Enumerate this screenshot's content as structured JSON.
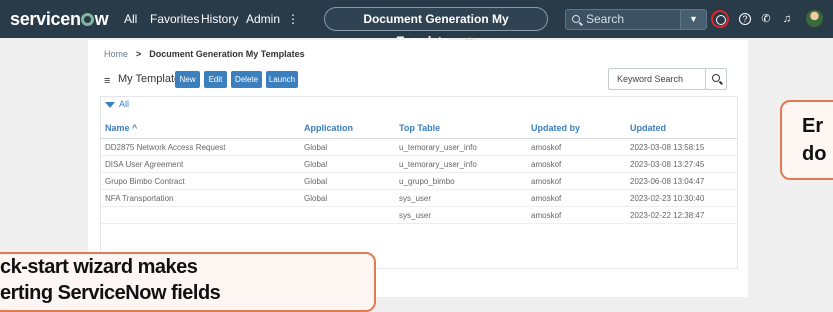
{
  "nav": {
    "logo_before": "servicen",
    "logo_after": "w",
    "items": [
      "All",
      "Favorites",
      "History",
      "Admin",
      "⋮"
    ],
    "document_title": "Document Generation My Template...",
    "star": "☆",
    "search_placeholder": "Search",
    "icons": [
      "globe-icon",
      "help-icon",
      "phone-icon",
      "bell-icon",
      "avatar"
    ]
  },
  "breadcrumb": {
    "home": "Home",
    "separator": ">",
    "current": "Document Generation My Templates"
  },
  "list": {
    "menu_glyph": "≡",
    "title": "My Templates",
    "buttons": [
      "New",
      "Edit",
      "Delete",
      "Launch"
    ],
    "search_placeholder": "Keyword Search",
    "filter_label": "All",
    "columns": [
      "Name ^",
      "Application",
      "Top Table",
      "Updated by",
      "Updated"
    ],
    "rows": [
      [
        "DD2875 Network Access Request",
        "Global",
        "u_temorary_user_info",
        "amoskof",
        "2023-03-08 13:58:15"
      ],
      [
        "DISA User Agreement",
        "Global",
        "u_temorary_user_info",
        "amoskof",
        "2023-03-08 13:27:45"
      ],
      [
        "Grupo Bimbo Contract",
        "Global",
        "u_grupo_bimbo",
        "amoskof",
        "2023-06-08 13:04:47"
      ],
      [
        "NFA Transportation",
        "Global",
        "sys_user",
        "amoskof",
        "2023-02-23 10:30:40"
      ],
      [
        "",
        "",
        "sys_user",
        "amoskof",
        "2023-02-22 12:38:47"
      ]
    ]
  },
  "callouts": {
    "left_line1": "ck-start wizard makes",
    "left_line2": "erting ServiceNow fields",
    "right_line1": "Er",
    "right_line2": "do"
  },
  "colors": {
    "nav_bg": "#293b49",
    "accent_blue": "#3c7fbf",
    "callout_border": "#e07b52",
    "highlight_red": "#e0232c"
  }
}
